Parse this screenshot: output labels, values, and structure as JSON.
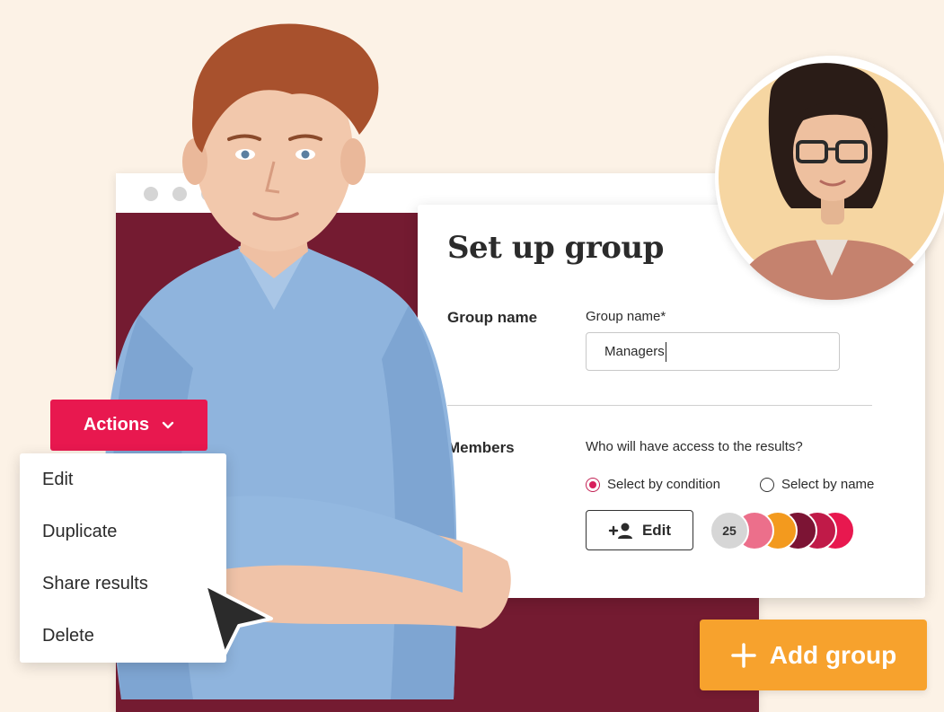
{
  "browser": {
    "dots": 3
  },
  "card": {
    "title": "Set up group",
    "group_name_section": "Group name",
    "group_name_label": "Group name*",
    "group_name_value": "Managers",
    "members_section": "Members",
    "members_section_visible": "mbers",
    "question": "Who will have access to the results?",
    "radio_condition": "Select by condition",
    "radio_name": "Select by name",
    "selected_radio": "Select by condition",
    "edit_label": "Edit",
    "member_count": "25",
    "avatar_colors": [
      "#ec6f8b",
      "#f39a1e",
      "#7c1434",
      "#c01a48",
      "#e8184f"
    ]
  },
  "actions": {
    "button_label": "Actions",
    "menu_items": [
      "Edit",
      "Duplicate",
      "Share results",
      "Delete"
    ]
  },
  "add_group": {
    "label": "Add group"
  },
  "colors": {
    "background": "#fcf2e6",
    "brand_maroon": "#741b31",
    "accent_pink": "#e8184f",
    "accent_orange": "#f7a22d"
  },
  "icons": [
    "add-person-icon",
    "chevron-down-icon",
    "plus-icon",
    "pointer-cursor-icon"
  ]
}
